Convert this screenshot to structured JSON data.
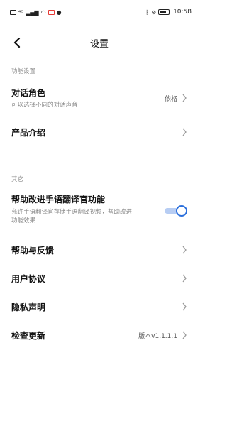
{
  "status_bar": {
    "left_items": [
      "4G",
      "signal",
      "wifi",
      "notification",
      "message"
    ],
    "bluetooth": "bluetooth-icon",
    "silent": "mute-icon",
    "battery": "battery-icon",
    "time": "10:58"
  },
  "header": {
    "title": "设置",
    "back_icon": "back-arrow-icon"
  },
  "sections": {
    "function_label": "功能设置",
    "other_label": "其它"
  },
  "rows": {
    "dialog_role": {
      "title": "对话角色",
      "subtitle": "可以选择不同的对话声音",
      "value": "依格"
    },
    "product_intro": {
      "title": "产品介绍"
    },
    "improve": {
      "title": "帮助改进手语翻译官功能",
      "subtitle_line1": "允许手语翻译官存储手语翻译视频，帮助改进",
      "subtitle_line2": "功能效果",
      "toggle_on": true
    },
    "help": {
      "title": "帮助与反馈"
    },
    "agreement": {
      "title": "用户协议"
    },
    "privacy": {
      "title": "隐私声明"
    },
    "update": {
      "title": "检查更新",
      "value": "版本v1.1.1.1"
    }
  },
  "colors": {
    "accent": "#2b6fdc",
    "track": "#b7cdf3"
  }
}
